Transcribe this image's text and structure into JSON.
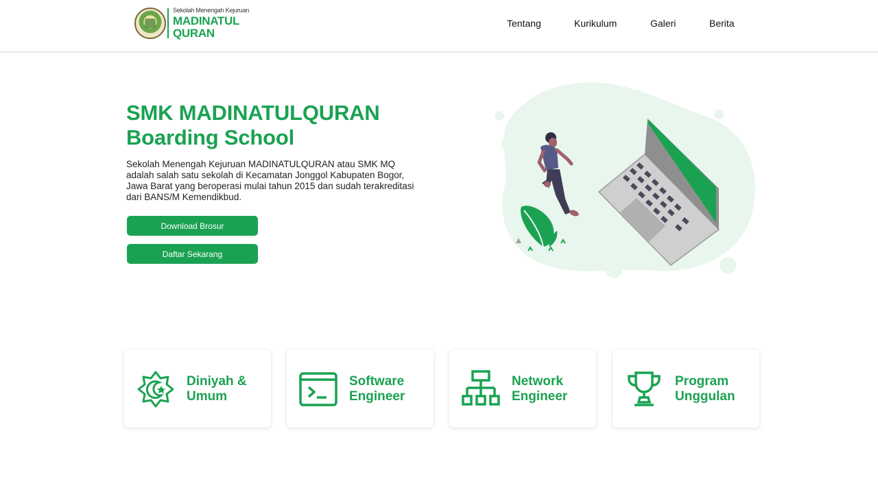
{
  "header": {
    "logo_small": "Sekolah Menengah Kejuruan",
    "logo_line1": "MADINATUL",
    "logo_line2": "QURAN",
    "nav": [
      {
        "label": "Tentang"
      },
      {
        "label": "Kurikulum"
      },
      {
        "label": "Galeri"
      },
      {
        "label": "Berita"
      }
    ]
  },
  "hero": {
    "title_line1": "SMK MADINATULQURAN",
    "title_line2": "Boarding School",
    "description": "Sekolah Menengah Kejuruan MADINATULQURAN atau SMK MQ adalah salah satu sekolah di Kecamatan Jonggol Kabupaten Bogor, Jawa Barat yang beroperasi mulai tahun 2015 dan sudah terakreditasi dari BANS/M Kemendikbud.",
    "btn_brochure": "Download Brosur",
    "btn_register": "Daftar Sekarang"
  },
  "cards": [
    {
      "line1": "Diniyah &",
      "line2": "Umum",
      "icon": "crescent-star-icon"
    },
    {
      "line1": "Software",
      "line2": "Engineer",
      "icon": "terminal-icon"
    },
    {
      "line1": "Network",
      "line2": "Engineer",
      "icon": "network-icon"
    },
    {
      "line1": "Program",
      "line2": "Unggulan",
      "icon": "trophy-icon"
    }
  ],
  "colors": {
    "accent": "#1aa252",
    "blob": "#e9f6ee"
  }
}
